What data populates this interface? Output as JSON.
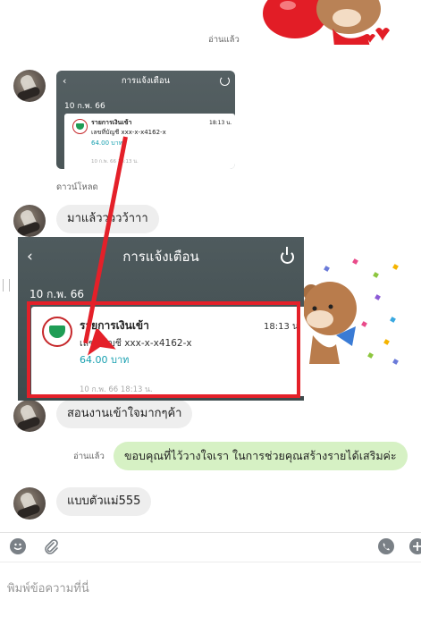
{
  "messages": {
    "read_label_top": "อ่านแล้ว",
    "download_label": "ดาวน์โหลด",
    "msg1": "มาแล้ววววว้าาา",
    "msg2": "สอนงานเข้าใจมากๆค้า",
    "read_label_out": "อ่านแล้ว",
    "msg_out": "ขอบคุณที่ไว้วางใจเรา ในการช่วยคุณสร้างรายได้เสริมค่ะ",
    "msg3": "แบบตัวแม่555"
  },
  "thumbnail": {
    "header_title": "การแจ้งเตือน",
    "date": "10 ก.พ. 66",
    "item_title": "รายการเงินเข้า",
    "item_time": "18:13 น.",
    "item_account": "เลขที่บัญชี xxx-x-x4162-x",
    "item_amount": "64.00 บาท",
    "item_footer": "10 ก.พ. 66 18:13 น."
  },
  "notification": {
    "back_glyph": "‹",
    "header_title": "การแจ้งเตือน",
    "date": "10 ก.พ. 66",
    "item_title": "รายการเงินเข้า",
    "item_time": "18:13 น.",
    "item_account": "เลขที่บัญชี xxx-x-x4162-x",
    "item_amount": "64.00 บาท",
    "item_footer": "10 ก.พ. 66 18:13 น."
  },
  "composer": {
    "placeholder": "พิมพ์ข้อความที่นี่"
  },
  "colors": {
    "accent_red": "#e42029",
    "bubble_out": "#d6f1c4",
    "bubble_in": "#eeeeee",
    "amount_teal": "#18a0b0"
  },
  "icons": [
    "emoji-icon",
    "attachment-icon",
    "voice-call-icon",
    "add-icon",
    "power-icon",
    "back-icon",
    "bank-logo-icon"
  ]
}
